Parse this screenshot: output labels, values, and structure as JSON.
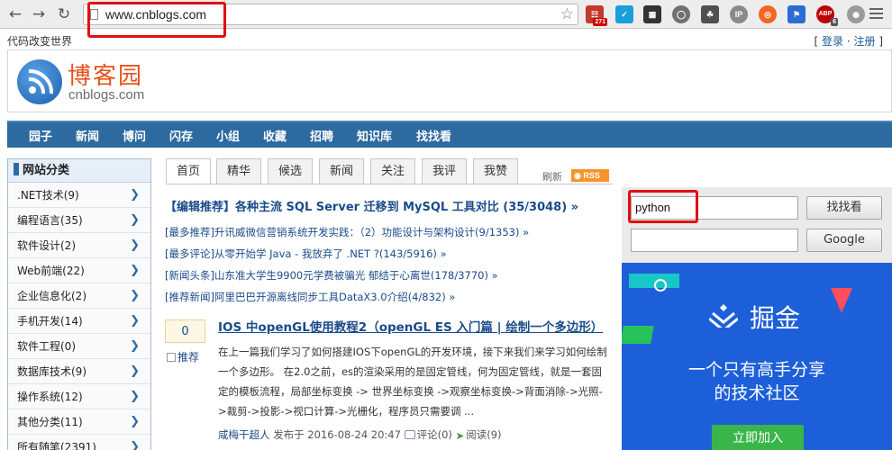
{
  "browser": {
    "url": "www.cnblogs.com",
    "extensions": [
      {
        "name": "counter-extension-icon",
        "badge": "271",
        "color": "#c0392b"
      },
      {
        "name": "pocket-icon",
        "color": "#1a9fd8"
      },
      {
        "name": "qr-code-icon",
        "color": "#333333"
      },
      {
        "name": "shield-icon",
        "color": "#707070"
      },
      {
        "name": "evernote-icon",
        "color": "#505050"
      },
      {
        "name": "ip-icon",
        "color": "#8a8a8a"
      },
      {
        "name": "lifebuoy-icon",
        "color": "#f26722"
      },
      {
        "name": "bookmark-icon",
        "color": "#2b6cd4"
      },
      {
        "name": "adblock-icon",
        "badge": "6",
        "color": "#c00000"
      },
      {
        "name": "globe-icon",
        "color": "#9a9a9a"
      }
    ],
    "ext_labels": {
      "ip": "IP",
      "abp": "ABP"
    }
  },
  "header": {
    "slogan": "代码改变世界",
    "login_open": "[ ",
    "login_text": "登录",
    "login_sep": " · ",
    "register_text": "注册",
    "login_close": " ]",
    "logo_title": "博客园",
    "logo_sub": "cnblogs.com"
  },
  "nav": [
    "园子",
    "新闻",
    "博问",
    "闪存",
    "小组",
    "收藏",
    "招聘",
    "知识库",
    "找找看"
  ],
  "sidebar": {
    "title": "网站分类",
    "items": [
      ".NET技术(9)",
      "编程语言(35)",
      "软件设计(2)",
      "Web前端(22)",
      "企业信息化(2)",
      "手机开发(14)",
      "软件工程(0)",
      "数据库技术(9)",
      "操作系统(12)",
      "其他分类(11)",
      "所有随笔(2391)"
    ]
  },
  "tabs": [
    "首页",
    "精华",
    "候选",
    "新闻",
    "关注",
    "我评",
    "我赞"
  ],
  "refresh": "刷新",
  "rss": "RSS",
  "headlines": {
    "main": "【编辑推荐】各种主流 SQL Server 迁移到 MySQL 工具对比 (35/3048) »",
    "items": [
      "[最多推荐]升讯威微信营销系统开发实践：（2）功能设计与架构设计(9/1353) »",
      "[最多评论]从零开始学 Java - 我放弃了 .NET ?(143/5916) »",
      "[新闻头条]山东准大学生9900元学费被骗光 郁结于心离世(178/3770) »",
      "[推荐新闻]阿里巴巴开源离线同步工具DataX3.0介绍(4/832) »"
    ]
  },
  "post": {
    "votes": "0",
    "recommend": "推荐",
    "title": "IOS 中openGL使用教程2（openGL ES 入门篇 | 绘制一个多边形）",
    "summary": "在上一篇我们学习了如何搭建IOS下openGL的开发环境，接下来我们来学习如何绘制一个多边形。 在2.0之前，es的渲染采用的是固定管线，何为固定管线，就是一套固定的模板流程，局部坐标变换 -> 世界坐标变换 ->观察坐标变换->背面消除->光照->裁剪->投影->视口计算->光栅化，程序员只需要调 ...",
    "author": "咸梅干超人",
    "published": " 发布于 2016-08-24 20:47 ",
    "comments": "评论(0)",
    "views": "阅读(9)"
  },
  "search": {
    "site_query": "python",
    "site_button": "找找看",
    "google_query": "",
    "google_button": "Google"
  },
  "ad": {
    "brand": "掘金",
    "line1": "一个只有高手分享",
    "line2": "的技术社区",
    "cta": "立即加入"
  },
  "colors": {
    "nav_bg": "#2d6aa0",
    "logo_orange": "#e8501c",
    "link_blue": "#1a4b8a",
    "highlight_red": "#e01010",
    "ad_blue": "#1d5fd8"
  }
}
